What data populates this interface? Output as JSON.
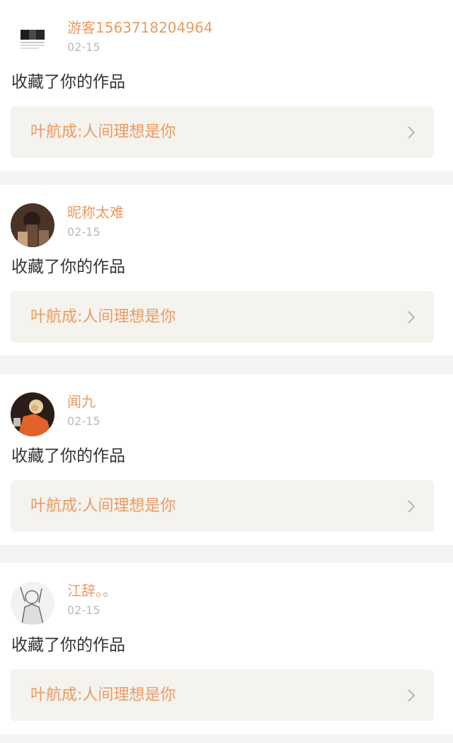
{
  "notifications": [
    {
      "avatar_icon": "user-avatar-photo",
      "username": "游客1563718204964",
      "date": "02-15",
      "action": "收藏了你的作品",
      "work_title": "叶航成:人间理想是你",
      "chevron_icon": "chevron-right-icon"
    },
    {
      "avatar_icon": "user-avatar-photo",
      "username": "昵称太难",
      "date": "02-15",
      "action": "收藏了你的作品",
      "work_title": "叶航成:人间理想是你",
      "chevron_icon": "chevron-right-icon"
    },
    {
      "avatar_icon": "user-avatar-photo",
      "username": "闻九",
      "date": "02-15",
      "action": "收藏了你的作品",
      "work_title": "叶航成:人间理想是你",
      "chevron_icon": "chevron-right-icon"
    },
    {
      "avatar_icon": "user-avatar-photo",
      "username": "江辞。。",
      "date": "02-15",
      "action": "收藏了你的作品",
      "work_title": "叶航成:人间理想是你",
      "chevron_icon": "chevron-right-icon"
    }
  ],
  "colors": {
    "accent": "#ec9a5f",
    "date": "#b9b9b9",
    "text": "#333333",
    "link_bg": "#f4f3ee",
    "separator": "#f5f4f2"
  }
}
